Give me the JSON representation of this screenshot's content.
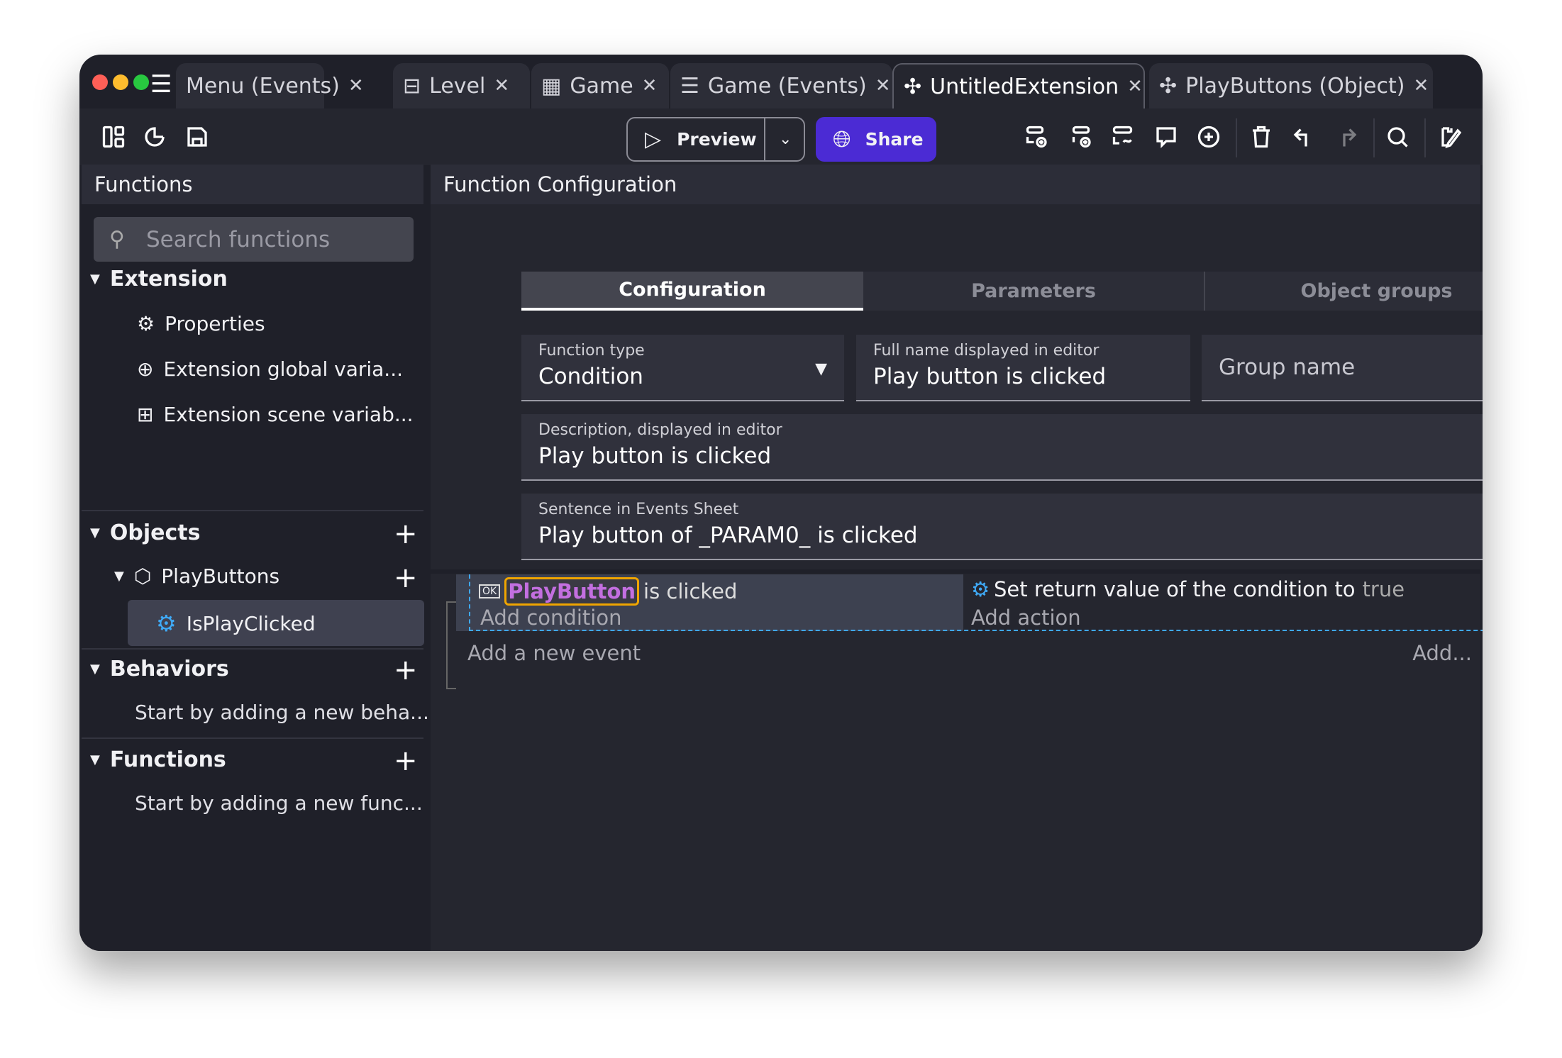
{
  "tabs": [
    {
      "label": "Menu (Events)",
      "icon": "menu-icon"
    },
    {
      "label": "Level",
      "icon": "scene-icon"
    },
    {
      "label": "Game",
      "icon": "film-icon"
    },
    {
      "label": "Game (Events)",
      "icon": "events-icon"
    },
    {
      "label": "UntitledExtension",
      "icon": "puzzle-icon",
      "active": true
    },
    {
      "label": "PlayButtons (Object)",
      "icon": "puzzle-icon"
    }
  ],
  "toolbar": {
    "preview": "Preview",
    "share": "Share",
    "share_color": "#4b2bd4"
  },
  "left": {
    "title": "Functions",
    "search_placeholder": "Search functions",
    "extension": "Extension",
    "properties": "Properties",
    "global_vars": "Extension global varia...",
    "scene_vars": "Extension scene variab...",
    "objects": "Objects",
    "playbuttons": "PlayButtons",
    "isplayclicked": "IsPlayClicked",
    "behaviors": "Behaviors",
    "behaviors_empty": "Start by adding a new beha...",
    "functions": "Functions",
    "functions_empty": "Start by adding a new func..."
  },
  "right": {
    "title": "Function Configuration",
    "tabs": [
      "Configuration",
      "Parameters",
      "Object groups"
    ],
    "function_type_label": "Function type",
    "function_type": "Condition",
    "fullname_label": "Full name displayed in editor",
    "fullname": "Play button is clicked",
    "group_placeholder": "Group name",
    "description_label": "Description, displayed in editor",
    "description": "Play button is clicked",
    "sentence_label": "Sentence in Events Sheet",
    "sentence": "Play button of _PARAM0_ is clicked"
  },
  "event": {
    "object": "PlayButton",
    "condition_text": "is clicked",
    "add_condition": "Add condition",
    "action_text": "Set return value of the condition to",
    "action_value": "true",
    "add_action": "Add action",
    "add_event": "Add a new event",
    "add_more": "Add..."
  }
}
